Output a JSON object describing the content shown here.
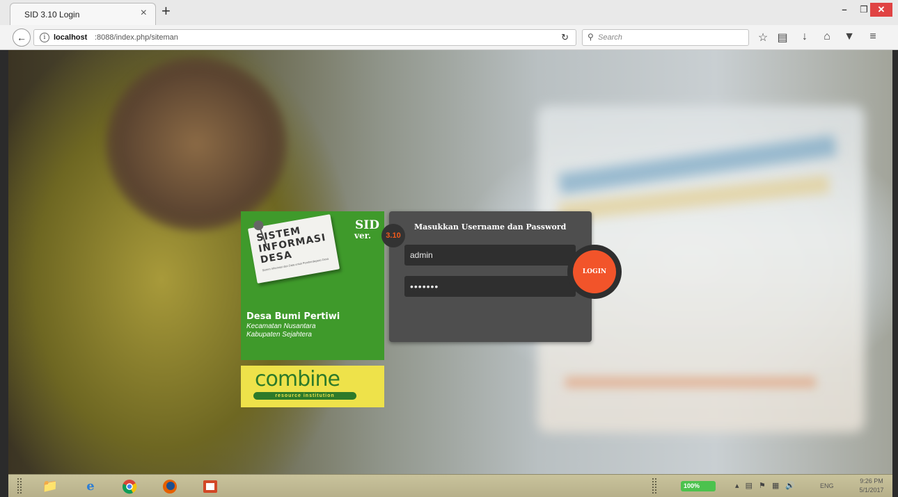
{
  "browser": {
    "tab_title": "SID 3.10 Login",
    "tab_close": "×",
    "new_tab": "+",
    "url_host": "localhost",
    "url_path": ":8088/index.php/siteman",
    "search_placeholder": "Search",
    "window_min": "–",
    "window_max": "❐",
    "window_close": "✕"
  },
  "brand": {
    "paper_line1": "SISTEM",
    "paper_line2": "INFORMASI",
    "paper_line3": "DESA",
    "paper_sub": "Sistem Informasi dan Data untuk Pemberdayaan Desa",
    "sid": "SID",
    "ver": "ver.",
    "version": "3.10",
    "village": "Desa Bumi Pertiwi",
    "district": "Kecamatan Nusantara",
    "regency": "Kabupaten Sejahtera"
  },
  "combine": {
    "word": "combine",
    "sub": "resource institution"
  },
  "login": {
    "title": "Masukkan Username dan Password",
    "username_value": "admin",
    "password_value": "•••••••",
    "button": "LOGIN"
  },
  "taskbar": {
    "battery": "100%",
    "language": "ENG",
    "time": "9:26 PM",
    "date": "5/1/2017"
  },
  "colors": {
    "brand_green": "#3f9a2b",
    "login_orange": "#f2542a",
    "panel_dark": "#4e4e4e",
    "combine_yellow": "#eee24a"
  }
}
